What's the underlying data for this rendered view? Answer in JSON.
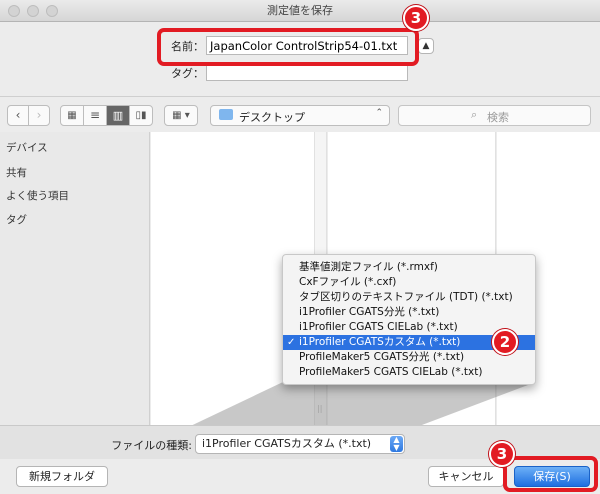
{
  "window": {
    "title": "測定値を保存"
  },
  "form": {
    "name_label": "名前：",
    "name_value": "JapanColor ControlStrip54-01.txt",
    "tag_label": "タグ：",
    "tag_value": ""
  },
  "toolbar": {
    "location": "デスクトップ",
    "search_placeholder": "検索"
  },
  "sidebar": {
    "sections": [
      "デバイス",
      "共有",
      "よく使う項目",
      "タグ"
    ]
  },
  "format": {
    "label": "ファイルの種類:",
    "selected": "i1Profiler CGATSカスタム (*.txt)",
    "options": [
      "基準値測定ファイル (*.rmxf)",
      "CxFファイル (*.cxf)",
      "タブ区切りのテキストファイル (TDT) (*.txt)",
      "i1Profiler CGATS分光 (*.txt)",
      "i1Profiler CGATS CIELab (*.txt)",
      "i1Profiler CGATSカスタム (*.txt)",
      "ProfileMaker5 CGATS分光 (*.txt)",
      "ProfileMaker5 CGATS CIELab (*.txt)"
    ],
    "selected_index": 5
  },
  "buttons": {
    "new_folder": "新規フォルダ",
    "cancel": "キャンセル",
    "save": "保存(S)"
  },
  "callouts": {
    "badge_top": "3",
    "badge_menu": "2",
    "badge_save": "3"
  },
  "colors": {
    "highlight": "#e21b23",
    "accent": "#2c72e1"
  }
}
